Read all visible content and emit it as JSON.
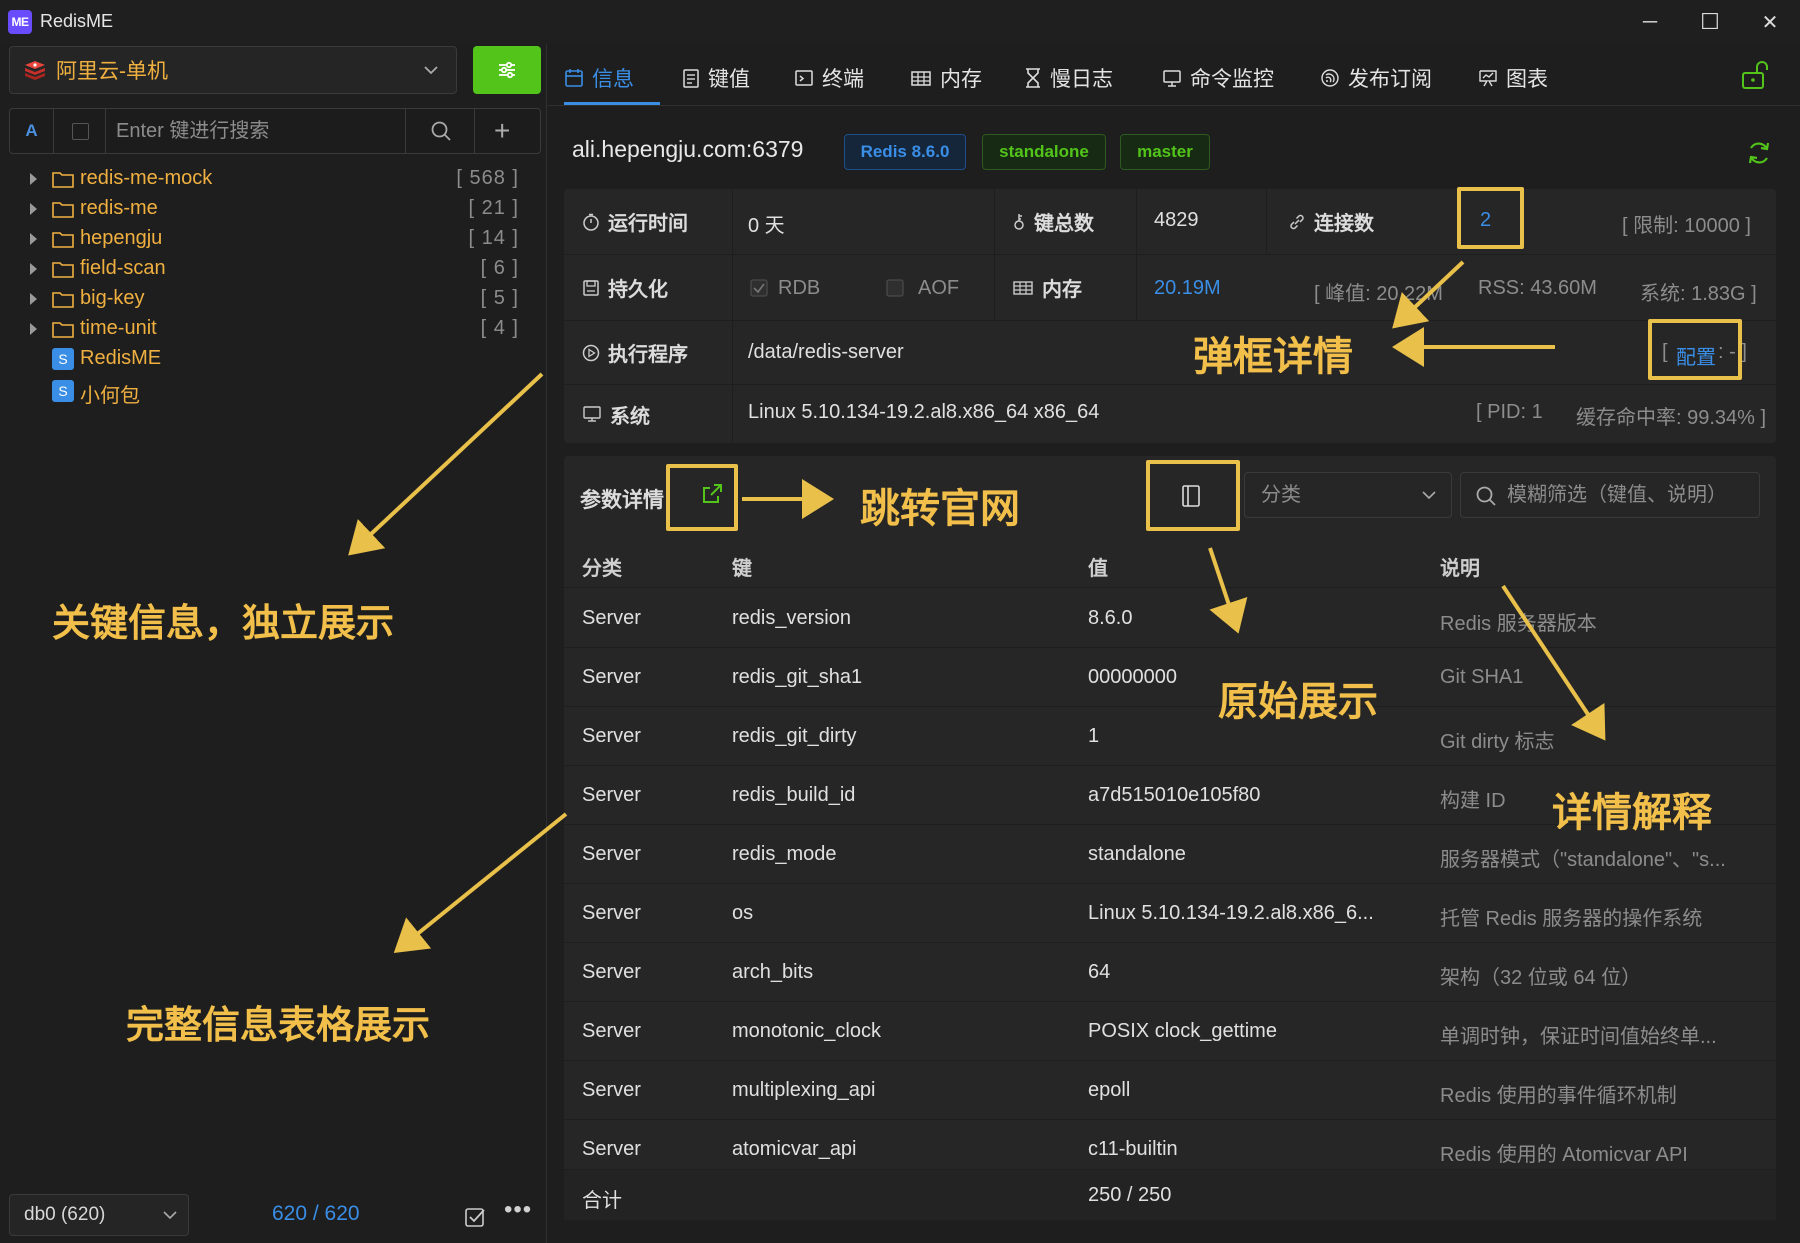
{
  "window": {
    "logo": "ME",
    "title": "RedisME",
    "minimize": "─",
    "maximize": "☐",
    "close": "✕"
  },
  "sidebar": {
    "connection": "阿里云-单机",
    "search": {
      "mode": "A",
      "placeholder": "Enter 键进行搜索"
    },
    "tree": [
      {
        "type": "folder",
        "name": "redis-me-mock",
        "count": "[ 568 ]"
      },
      {
        "type": "folder",
        "name": "redis-me",
        "count": "[ 21 ]"
      },
      {
        "type": "folder",
        "name": "hepengju",
        "count": "[ 14 ]"
      },
      {
        "type": "folder",
        "name": "field-scan",
        "count": "[ 6 ]"
      },
      {
        "type": "folder",
        "name": "big-key",
        "count": "[ 5 ]"
      },
      {
        "type": "folder",
        "name": "time-unit",
        "count": "[ 4 ]"
      },
      {
        "type": "string",
        "name": "RedisME",
        "badge": "S"
      },
      {
        "type": "string",
        "name": "小何包",
        "badge": "S"
      }
    ],
    "db": "db0 (620)",
    "key_count": "620 / 620",
    "more": "•••"
  },
  "tabs": [
    "信息",
    "键值",
    "终端",
    "内存",
    "慢日志",
    "命令监控",
    "发布订阅",
    "图表"
  ],
  "server": {
    "host": "ali.hepengju.com:6379",
    "version": "Redis 8.6.0",
    "mode": "standalone",
    "role": "master"
  },
  "info": {
    "uptime_label": "运行时间",
    "uptime": "0 天",
    "keys_label": "键总数",
    "keys": "4829",
    "conn_label": "连接数",
    "conn": "2",
    "conn_limit": "[ 限制: 10000 ]",
    "persist_label": "持久化",
    "rdb": "RDB",
    "aof": "AOF",
    "mem_label": "内存",
    "mem": "20.19M",
    "mem_peak": "[ 峰值: 20.22M",
    "mem_rss": "RSS: 43.60M",
    "mem_sys": "系统: 1.83G ]",
    "exec_label": "执行程序",
    "exec": "/data/redis-server",
    "config_open": "[ ",
    "config": "配置",
    "config_close": ": - ]",
    "sys_label": "系统",
    "sys": "Linux 5.10.134-19.2.al8.x86_64 x86_64",
    "pid": "[ PID: 1",
    "hit_rate": "缓存命中率: 99.34% ]"
  },
  "params": {
    "title": "参数详情",
    "category_placeholder": "分类",
    "filter_placeholder": "模糊筛选（键值、说明）",
    "headers": [
      "分类",
      "键",
      "值",
      "说明"
    ],
    "rows": [
      [
        "Server",
        "redis_version",
        "8.6.0",
        "Redis 服务器版本"
      ],
      [
        "Server",
        "redis_git_sha1",
        "00000000",
        "Git SHA1"
      ],
      [
        "Server",
        "redis_git_dirty",
        "1",
        "Git dirty 标志"
      ],
      [
        "Server",
        "redis_build_id",
        "a7d515010e105f80",
        "构建 ID"
      ],
      [
        "Server",
        "redis_mode",
        "standalone",
        "服务器模式（\"standalone\"、\"s..."
      ],
      [
        "Server",
        "os",
        "Linux 5.10.134-19.2.al8.x86_6...",
        "托管 Redis 服务器的操作系统"
      ],
      [
        "Server",
        "arch_bits",
        "64",
        "架构（32 位或 64 位）"
      ],
      [
        "Server",
        "monotonic_clock",
        "POSIX clock_gettime",
        "单调时钟，保证时间值始终单..."
      ],
      [
        "Server",
        "multiplexing_api",
        "epoll",
        "Redis 使用的事件循环机制"
      ],
      [
        "Server",
        "atomicvar_api",
        "c11-builtin",
        "Redis 使用的 Atomicvar API"
      ]
    ],
    "footer_label": "合计",
    "footer_value": "250 / 250"
  },
  "annotations": {
    "key_info": "关键信息，独立展示",
    "full_table": "完整信息表格展示",
    "popup": "弹框详情",
    "official": "跳转官网",
    "raw": "原始展示",
    "explain": "详情解释"
  },
  "colors": {
    "accent": "#3a8ee6",
    "success": "#52c41a",
    "folder": "#f0b040",
    "annotation": "#f2c04a"
  }
}
